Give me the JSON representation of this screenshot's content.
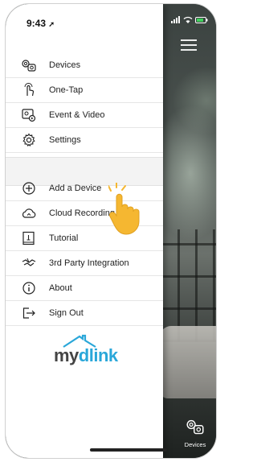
{
  "status": {
    "time": "9:43"
  },
  "menu_primary": [
    {
      "label": "Devices",
      "icon": "camera-icon"
    },
    {
      "label": "One-Tap",
      "icon": "one-tap-hand-icon"
    },
    {
      "label": "Event & Video",
      "icon": "event-video-icon"
    },
    {
      "label": "Settings",
      "icon": "gear-icon"
    }
  ],
  "menu_secondary": [
    {
      "label": "Add a Device",
      "icon": "plus-circle-icon"
    },
    {
      "label": "Cloud Recording",
      "icon": "cloud-icon"
    },
    {
      "label": "Tutorial",
      "icon": "book-icon"
    },
    {
      "label": "3rd Party Integration",
      "icon": "integration-icon"
    },
    {
      "label": "About",
      "icon": "info-icon"
    },
    {
      "label": "Sign Out",
      "icon": "sign-out-icon"
    }
  ],
  "logo": {
    "text": "mydlink",
    "my": "my",
    "dlink": "dlink"
  },
  "bottom_nav": {
    "devices_label": "Devices"
  },
  "colors": {
    "accent": "#2aa7d9",
    "hand": "#f5b731"
  }
}
